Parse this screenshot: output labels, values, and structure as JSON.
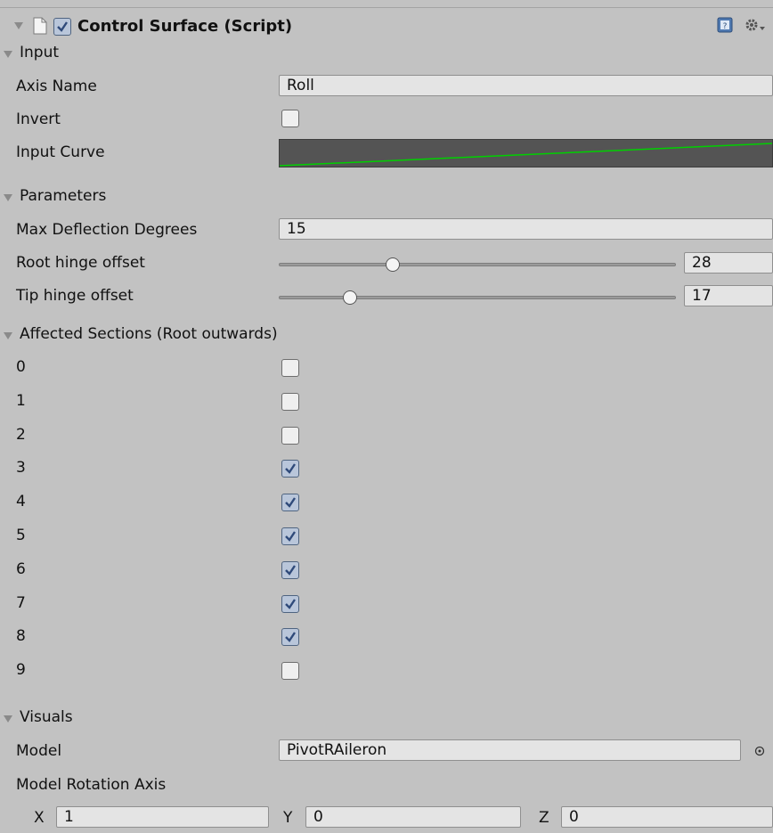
{
  "header": {
    "title": "Control Surface (Script)",
    "enabled": true
  },
  "input": {
    "section_label": "Input",
    "axis_name_label": "Axis Name",
    "axis_name_value": "Roll",
    "invert_label": "Invert",
    "invert_checked": false,
    "input_curve_label": "Input Curve"
  },
  "parameters": {
    "section_label": "Parameters",
    "max_deflection_label": "Max Deflection Degrees",
    "max_deflection_value": "15",
    "root_hinge_label": "Root hinge offset",
    "root_hinge_value": "28",
    "tip_hinge_label": "Tip hinge offset",
    "tip_hinge_value": "17"
  },
  "affected": {
    "section_label": "Affected Sections (Root outwards)",
    "items": [
      {
        "label": "0",
        "checked": false
      },
      {
        "label": "1",
        "checked": false
      },
      {
        "label": "2",
        "checked": false
      },
      {
        "label": "3",
        "checked": true
      },
      {
        "label": "4",
        "checked": true
      },
      {
        "label": "5",
        "checked": true
      },
      {
        "label": "6",
        "checked": true
      },
      {
        "label": "7",
        "checked": true
      },
      {
        "label": "8",
        "checked": true
      },
      {
        "label": "9",
        "checked": false
      }
    ]
  },
  "visuals": {
    "section_label": "Visuals",
    "model_label": "Model",
    "model_value": "PivotRAileron",
    "rotation_axis_label": "Model Rotation Axis",
    "x_label": "X",
    "x_value": "1",
    "y_label": "Y",
    "y_value": "0",
    "z_label": "Z",
    "z_value": "0"
  },
  "colors": {
    "background": "#c2c2c2",
    "curve_line": "#00d000",
    "curve_bg": "#545454",
    "checkbox_checked": "#4f6fa8"
  }
}
